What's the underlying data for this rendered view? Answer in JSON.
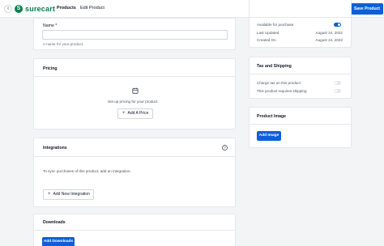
{
  "header": {
    "back_icon": "arrow-left-icon",
    "logo_text": "surecart",
    "breadcrumb_products": "Products",
    "breadcrumb_sep": "›",
    "breadcrumb_current": "Edit Product",
    "save_label": "Save Product",
    "accent": "#0d5fd8",
    "brand": "#01824c"
  },
  "name_card": {
    "label": "Name *",
    "value": "",
    "help": "A name for your product."
  },
  "pricing": {
    "title": "Pricing",
    "icon": "calendar-icon",
    "empty_text": "Set up pricing for your product.",
    "add_label": "Add A Price"
  },
  "integrations": {
    "title": "Integrations",
    "help_icon": "question-circle-icon",
    "text": "To sync purchases of this product, add an integration.",
    "add_label": "Add New Integration"
  },
  "downloads": {
    "title": "Downloads",
    "add_label": "Add Downloads"
  },
  "status_card": {
    "available_label": "Available for purchase",
    "available_on": true,
    "last_updated_label": "Last Updated",
    "last_updated_value": "August 24, 2022",
    "created_label": "Created On",
    "created_value": "August 24, 2022"
  },
  "tax_card": {
    "title": "Tax and Shipping",
    "charge_tax_label": "Charge tax on this product",
    "charge_tax_on": false,
    "requires_shipping_label": "This product requires shipping",
    "requires_shipping_on": false
  },
  "image_card": {
    "title": "Product Image",
    "add_label": "Add Image"
  }
}
